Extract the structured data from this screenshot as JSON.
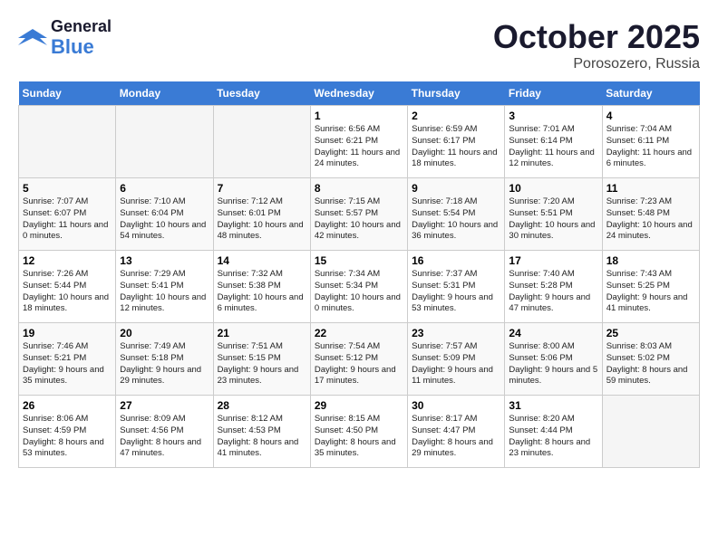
{
  "header": {
    "logo_general": "General",
    "logo_blue": "Blue",
    "month": "October 2025",
    "location": "Porosozero, Russia"
  },
  "days_of_week": [
    "Sunday",
    "Monday",
    "Tuesday",
    "Wednesday",
    "Thursday",
    "Friday",
    "Saturday"
  ],
  "weeks": [
    [
      {
        "num": "",
        "info": ""
      },
      {
        "num": "",
        "info": ""
      },
      {
        "num": "",
        "info": ""
      },
      {
        "num": "1",
        "info": "Sunrise: 6:56 AM\nSunset: 6:21 PM\nDaylight: 11 hours\nand 24 minutes."
      },
      {
        "num": "2",
        "info": "Sunrise: 6:59 AM\nSunset: 6:17 PM\nDaylight: 11 hours\nand 18 minutes."
      },
      {
        "num": "3",
        "info": "Sunrise: 7:01 AM\nSunset: 6:14 PM\nDaylight: 11 hours\nand 12 minutes."
      },
      {
        "num": "4",
        "info": "Sunrise: 7:04 AM\nSunset: 6:11 PM\nDaylight: 11 hours\nand 6 minutes."
      }
    ],
    [
      {
        "num": "5",
        "info": "Sunrise: 7:07 AM\nSunset: 6:07 PM\nDaylight: 11 hours\nand 0 minutes."
      },
      {
        "num": "6",
        "info": "Sunrise: 7:10 AM\nSunset: 6:04 PM\nDaylight: 10 hours\nand 54 minutes."
      },
      {
        "num": "7",
        "info": "Sunrise: 7:12 AM\nSunset: 6:01 PM\nDaylight: 10 hours\nand 48 minutes."
      },
      {
        "num": "8",
        "info": "Sunrise: 7:15 AM\nSunset: 5:57 PM\nDaylight: 10 hours\nand 42 minutes."
      },
      {
        "num": "9",
        "info": "Sunrise: 7:18 AM\nSunset: 5:54 PM\nDaylight: 10 hours\nand 36 minutes."
      },
      {
        "num": "10",
        "info": "Sunrise: 7:20 AM\nSunset: 5:51 PM\nDaylight: 10 hours\nand 30 minutes."
      },
      {
        "num": "11",
        "info": "Sunrise: 7:23 AM\nSunset: 5:48 PM\nDaylight: 10 hours\nand 24 minutes."
      }
    ],
    [
      {
        "num": "12",
        "info": "Sunrise: 7:26 AM\nSunset: 5:44 PM\nDaylight: 10 hours\nand 18 minutes."
      },
      {
        "num": "13",
        "info": "Sunrise: 7:29 AM\nSunset: 5:41 PM\nDaylight: 10 hours\nand 12 minutes."
      },
      {
        "num": "14",
        "info": "Sunrise: 7:32 AM\nSunset: 5:38 PM\nDaylight: 10 hours\nand 6 minutes."
      },
      {
        "num": "15",
        "info": "Sunrise: 7:34 AM\nSunset: 5:34 PM\nDaylight: 10 hours\nand 0 minutes."
      },
      {
        "num": "16",
        "info": "Sunrise: 7:37 AM\nSunset: 5:31 PM\nDaylight: 9 hours\nand 53 minutes."
      },
      {
        "num": "17",
        "info": "Sunrise: 7:40 AM\nSunset: 5:28 PM\nDaylight: 9 hours\nand 47 minutes."
      },
      {
        "num": "18",
        "info": "Sunrise: 7:43 AM\nSunset: 5:25 PM\nDaylight: 9 hours\nand 41 minutes."
      }
    ],
    [
      {
        "num": "19",
        "info": "Sunrise: 7:46 AM\nSunset: 5:21 PM\nDaylight: 9 hours\nand 35 minutes."
      },
      {
        "num": "20",
        "info": "Sunrise: 7:49 AM\nSunset: 5:18 PM\nDaylight: 9 hours\nand 29 minutes."
      },
      {
        "num": "21",
        "info": "Sunrise: 7:51 AM\nSunset: 5:15 PM\nDaylight: 9 hours\nand 23 minutes."
      },
      {
        "num": "22",
        "info": "Sunrise: 7:54 AM\nSunset: 5:12 PM\nDaylight: 9 hours\nand 17 minutes."
      },
      {
        "num": "23",
        "info": "Sunrise: 7:57 AM\nSunset: 5:09 PM\nDaylight: 9 hours\nand 11 minutes."
      },
      {
        "num": "24",
        "info": "Sunrise: 8:00 AM\nSunset: 5:06 PM\nDaylight: 9 hours\nand 5 minutes."
      },
      {
        "num": "25",
        "info": "Sunrise: 8:03 AM\nSunset: 5:02 PM\nDaylight: 8 hours\nand 59 minutes."
      }
    ],
    [
      {
        "num": "26",
        "info": "Sunrise: 8:06 AM\nSunset: 4:59 PM\nDaylight: 8 hours\nand 53 minutes."
      },
      {
        "num": "27",
        "info": "Sunrise: 8:09 AM\nSunset: 4:56 PM\nDaylight: 8 hours\nand 47 minutes."
      },
      {
        "num": "28",
        "info": "Sunrise: 8:12 AM\nSunset: 4:53 PM\nDaylight: 8 hours\nand 41 minutes."
      },
      {
        "num": "29",
        "info": "Sunrise: 8:15 AM\nSunset: 4:50 PM\nDaylight: 8 hours\nand 35 minutes."
      },
      {
        "num": "30",
        "info": "Sunrise: 8:17 AM\nSunset: 4:47 PM\nDaylight: 8 hours\nand 29 minutes."
      },
      {
        "num": "31",
        "info": "Sunrise: 8:20 AM\nSunset: 4:44 PM\nDaylight: 8 hours\nand 23 minutes."
      },
      {
        "num": "",
        "info": ""
      }
    ]
  ]
}
